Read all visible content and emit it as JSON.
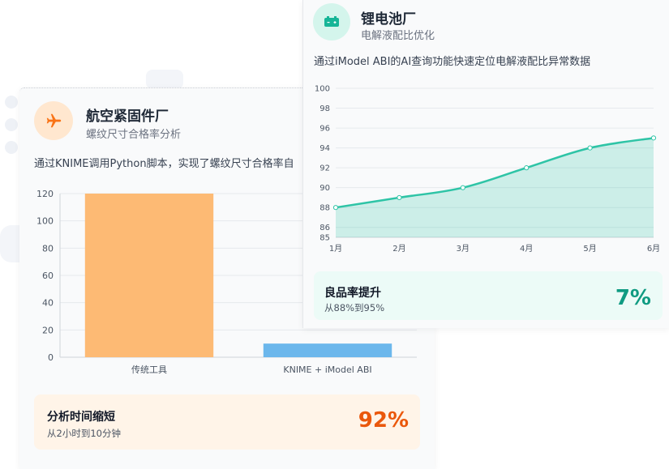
{
  "aero_card": {
    "title": "航空紧固件厂",
    "subtitle": "螺纹尺寸合格率分析",
    "description": "通过KNIME调用Python脚本，实现了螺纹尺寸合格率自",
    "icon": "airplane-icon",
    "accent": "#f97316",
    "stat": {
      "label": "分析时间缩短",
      "sub": "从2小时到10分钟",
      "value": "92%"
    }
  },
  "battery_card": {
    "title": "锂电池厂",
    "subtitle": "电解液配比优化",
    "description": "通过iModel ABI的AI查询功能快速定位电解液配比异常数据",
    "icon": "battery-icon",
    "accent": "#2ec4a6",
    "stat": {
      "label": "良品率提升",
      "sub": "从88%到95%",
      "value": "7%"
    }
  },
  "chart_data": [
    {
      "type": "bar",
      "categories": [
        "传统工具",
        "KNIME + iModel ABI"
      ],
      "values": [
        120,
        10
      ],
      "colors": [
        "#fdba74",
        "#6cb7ec"
      ],
      "ylim": [
        0,
        120
      ],
      "yticks": [
        0,
        20,
        40,
        60,
        80,
        100,
        120
      ],
      "grid": true
    },
    {
      "type": "area",
      "categories": [
        "1月",
        "2月",
        "3月",
        "4月",
        "5月",
        "6月"
      ],
      "values": [
        88,
        89,
        90,
        92,
        94,
        95
      ],
      "ylim": [
        85,
        100
      ],
      "yticks": [
        85,
        86,
        88,
        90,
        92,
        94,
        96,
        98,
        100
      ],
      "color": "#2ec4a6",
      "grid": true
    }
  ]
}
